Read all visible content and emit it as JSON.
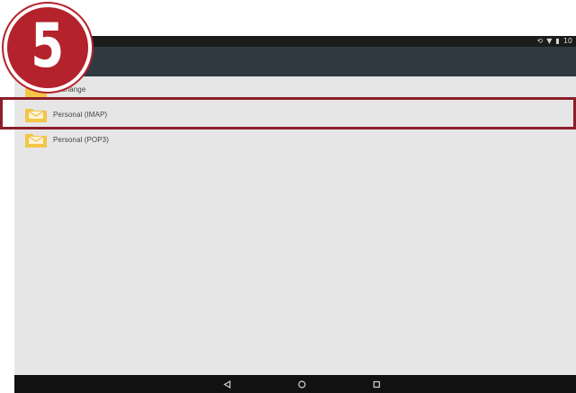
{
  "step": {
    "number": "5"
  },
  "statusbar": {
    "icons": [
      "sync-icon",
      "wifi-icon",
      "battery-icon"
    ],
    "time": "10"
  },
  "accounts": [
    {
      "label": "Exchange",
      "icon": "folder-icon"
    },
    {
      "label": "Personal (IMAP)",
      "icon": "folder-mail-icon"
    },
    {
      "label": "Personal (POP3)",
      "icon": "folder-mail-icon"
    }
  ],
  "navbar": {
    "buttons": [
      "back-icon",
      "home-icon",
      "recents-icon"
    ]
  },
  "colors": {
    "highlight": "#8c1e2a",
    "badge": "#b4222c",
    "actionbar": "#2f3a40",
    "folder": "#f3c648"
  }
}
